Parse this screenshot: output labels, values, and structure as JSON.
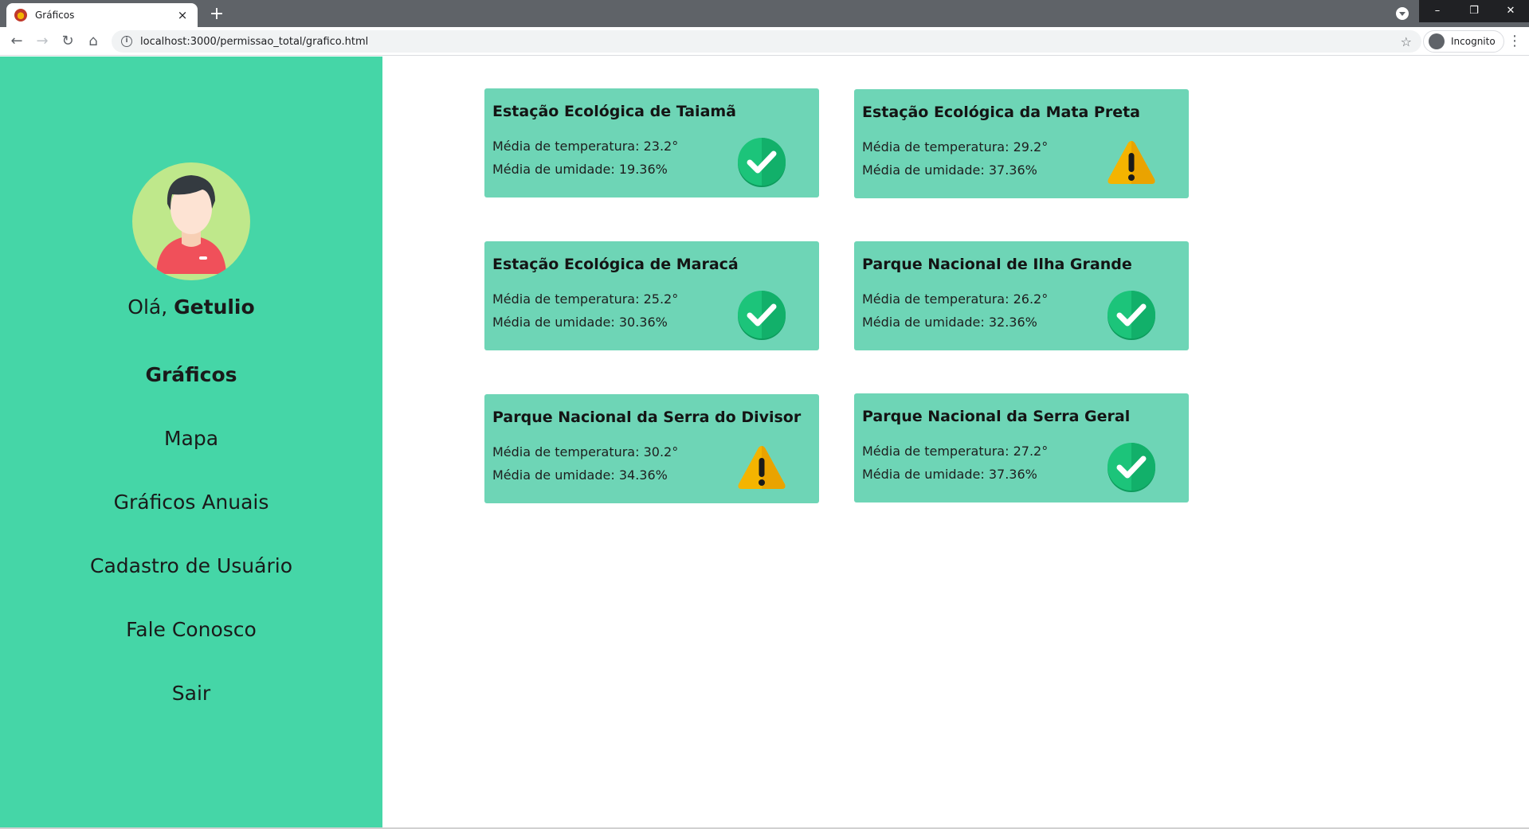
{
  "browser": {
    "tab_title": "Gráficos",
    "tab_close": "×",
    "new_tab": "+",
    "url": "localhost:3000/permissao_total/grafico.html",
    "incognito_label": "Incognito",
    "window_controls": [
      "–",
      "❐",
      "✕"
    ]
  },
  "sidebar": {
    "greeting_prefix": "Olá, ",
    "user_name": "Getulio",
    "nav": [
      {
        "label": "Gráficos",
        "active": true
      },
      {
        "label": "Mapa"
      },
      {
        "label": "Gráficos Anuais"
      },
      {
        "label": "Cadastro de Usuário"
      },
      {
        "label": "Fale Conosco"
      },
      {
        "label": "Sair"
      }
    ]
  },
  "cards": [
    {
      "title": "Estação Ecológica de Taiamã",
      "temp": "Média de temperatura: 23.2°",
      "humidity": "Média de umidade: 19.36%",
      "status": "ok"
    },
    {
      "title": "Estação Ecológica da Mata Preta",
      "temp": "Média de temperatura: 29.2°",
      "humidity": "Média de umidade: 37.36%",
      "status": "warning"
    },
    {
      "title": "Estação Ecológica de Maracá",
      "temp": "Média de temperatura: 25.2°",
      "humidity": "Média de umidade: 30.36%",
      "status": "ok"
    },
    {
      "title": "Parque Nacional de Ilha Grande",
      "temp": "Média de temperatura: 26.2°",
      "humidity": "Média de umidade: 32.36%",
      "status": "ok"
    },
    {
      "title": "Parque Nacional da Serra do Divisor",
      "temp": "Média de temperatura: 30.2°",
      "humidity": "Média de umidade: 34.36%",
      "status": "warning"
    },
    {
      "title": "Parque Nacional da Serra Geral",
      "temp": "Média de temperatura: 27.2°",
      "humidity": "Média de umidade: 37.36%",
      "status": "ok"
    }
  ],
  "colors": {
    "sidebar": "#45d6a7",
    "card": "#6ed5b6",
    "ok_icon": "#1cc47a",
    "warning_icon": "#f4b400"
  }
}
